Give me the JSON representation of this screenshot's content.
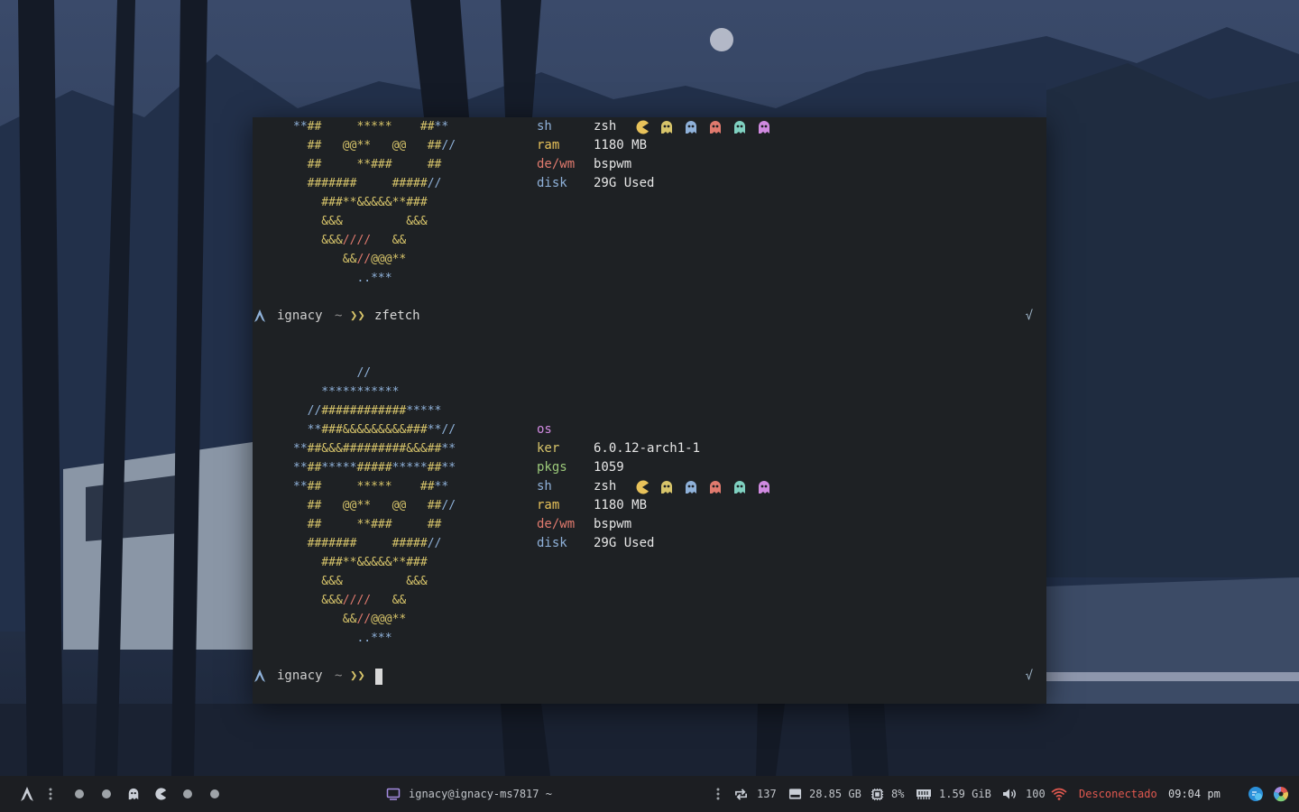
{
  "terminal": {
    "top_partial_art": [
      "**##     *****    ##**",
      "  ##   @@**   @@   ##//",
      "  ##     **###     ##",
      "  #######     #####//",
      "    ###**&&&&&**###",
      "    &&&         &&&",
      "    &&&////   &&",
      "       &&//@@@**",
      "         ..***"
    ],
    "top_partial_info": [
      {
        "key": "sh",
        "value": "zsh"
      },
      {
        "key": "ram",
        "value": "1180 MB"
      },
      {
        "key": "de/wm",
        "value": "bspwm"
      },
      {
        "key": "disk",
        "value": "29G Used"
      }
    ],
    "prompt1": {
      "user": "ignacy",
      "tilde": "~",
      "arrows": "❯❯",
      "command": "zfetch",
      "status": "√"
    },
    "art": [
      "         //",
      "    ***********",
      "  //############*****",
      "  **###&&&&&&&&&###**//",
      "**##&&&#########&&&##**",
      "**##*****#####*****##**",
      "**##     *****    ##**",
      "  ##   @@**   @@   ##//",
      "  ##     **###     ##",
      "  #######     #####//",
      "    ###**&&&&&**###",
      "    &&&         &&&",
      "    &&&////   &&",
      "       &&//@@@**",
      "         ..***"
    ],
    "info": [
      {
        "key": "os",
        "value": ""
      },
      {
        "key": "ker",
        "value": "6.0.12-arch1-1"
      },
      {
        "key": "pkgs",
        "value": "1059"
      },
      {
        "key": "sh",
        "value": "zsh"
      },
      {
        "key": "ram",
        "value": "1180 MB"
      },
      {
        "key": "de/wm",
        "value": "bspwm"
      },
      {
        "key": "disk",
        "value": "29G Used"
      }
    ],
    "ghost_colors": [
      "#e8c25a",
      "#d7c46a",
      "#8fb1d9",
      "#e07a6e",
      "#7fd0c0",
      "#d08ae0"
    ],
    "prompt2": {
      "user": "ignacy",
      "tilde": "~",
      "arrows": "❯❯",
      "command": "",
      "status": "√"
    }
  },
  "taskbar": {
    "window_title": "ignacy@ignacy-ms7817 ~",
    "updates": "137",
    "disk": "28.85 GB",
    "cpu": "8%",
    "memory": "1.59 GiB",
    "volume": "100",
    "network": "Desconectado",
    "clock": "09:04 pm",
    "network_color": "#e0584f"
  }
}
